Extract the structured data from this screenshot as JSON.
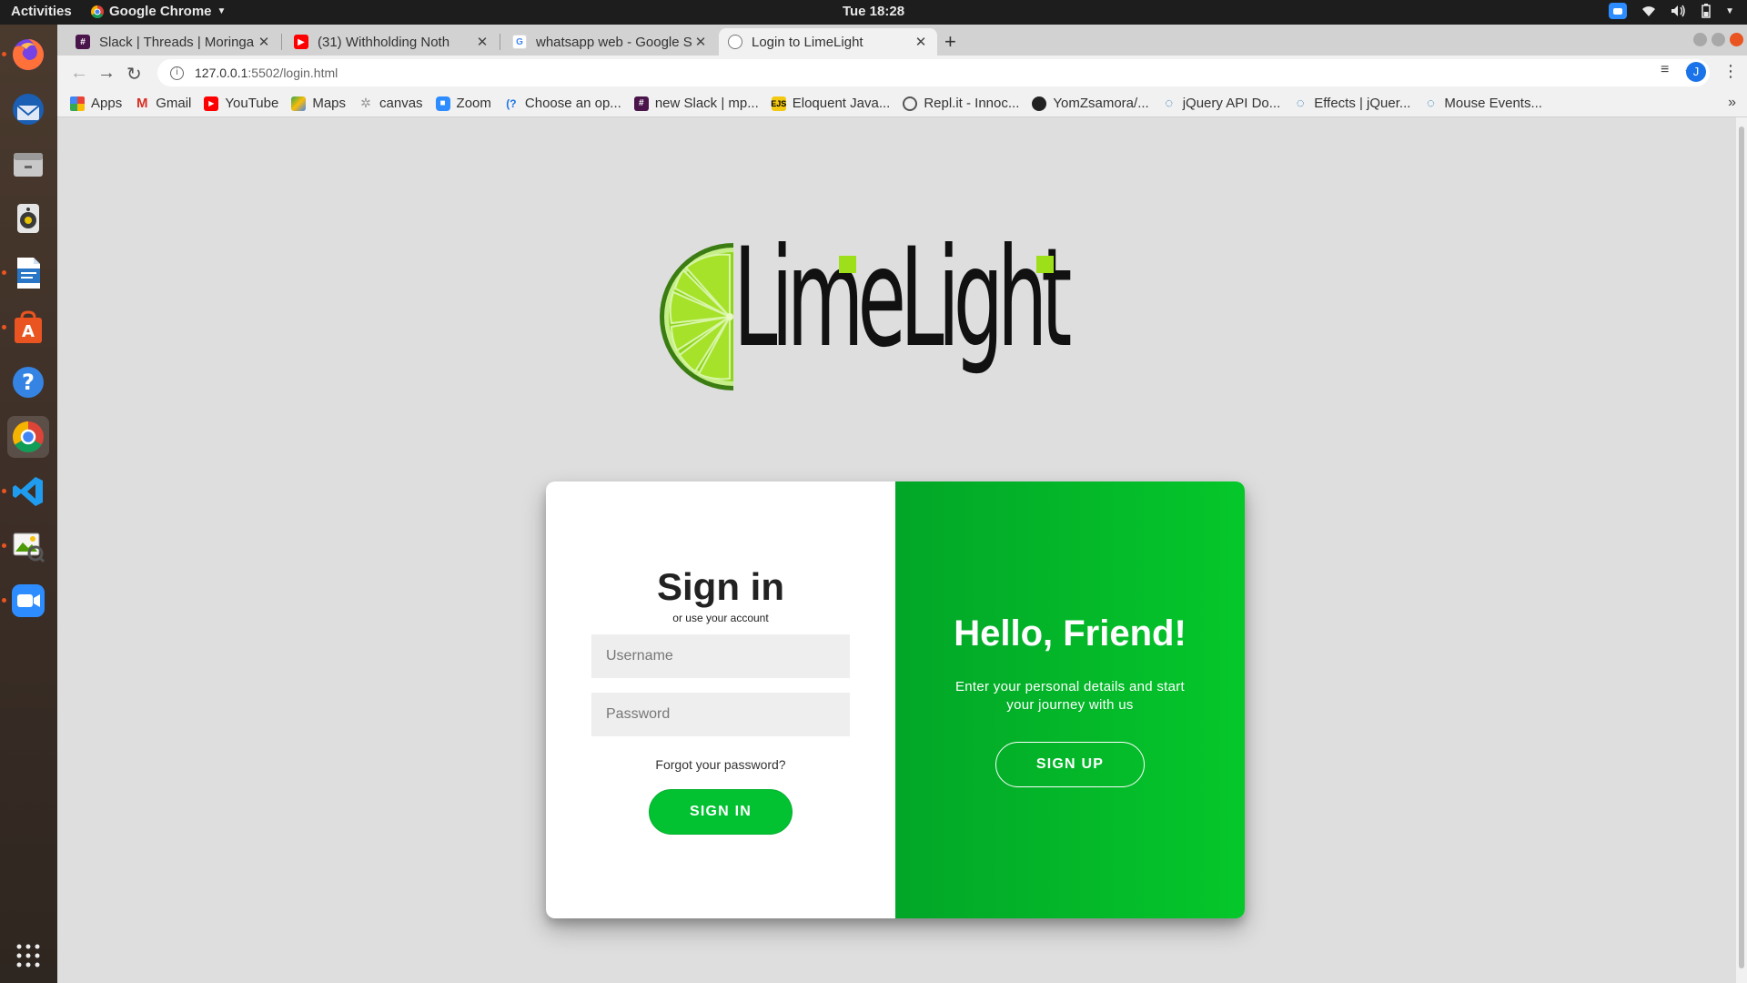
{
  "topbar": {
    "activities": "Activities",
    "app_name": "Google Chrome",
    "clock": "Tue 18:28"
  },
  "dock": {
    "items": [
      "firefox",
      "thunderbird",
      "files",
      "rhythmbox",
      "libreoffice-writer",
      "software-center",
      "help",
      "chrome",
      "vscode",
      "image-viewer",
      "zoom",
      "show-apps"
    ]
  },
  "browser": {
    "tabs": [
      {
        "title": "Slack | Threads | Moringa",
        "icon": "slack-icon"
      },
      {
        "title": "(31) Withholding Noth",
        "icon": "youtube-icon"
      },
      {
        "title": "whatsapp web - Google S",
        "icon": "google-icon"
      },
      {
        "title": "Login to LimeLight",
        "icon": "globe-icon",
        "active": true
      }
    ],
    "url_host": "127.0.0.1",
    "url_path": ":5502/login.html",
    "profile_initial": "J",
    "bookmarks": [
      {
        "label": "Apps",
        "icon": "apps-grid-icon"
      },
      {
        "label": "Gmail",
        "icon": "gmail-icon"
      },
      {
        "label": "YouTube",
        "icon": "youtube-icon"
      },
      {
        "label": "Maps",
        "icon": "maps-icon"
      },
      {
        "label": "canvas",
        "icon": "canvas-icon"
      },
      {
        "label": "Zoom",
        "icon": "zoom-icon"
      },
      {
        "label": "Choose an op...",
        "icon": "choose-icon"
      },
      {
        "label": "new Slack | mp...",
        "icon": "slack-icon"
      },
      {
        "label": "Eloquent Java...",
        "icon": "ejs-icon"
      },
      {
        "label": "Repl.it - Innoc...",
        "icon": "replit-icon"
      },
      {
        "label": "YomZsamora/...",
        "icon": "github-icon"
      },
      {
        "label": "jQuery API Do...",
        "icon": "jquery-icon"
      },
      {
        "label": "Effects | jQuer...",
        "icon": "jquery-icon"
      },
      {
        "label": "Mouse Events...",
        "icon": "jquery-icon"
      }
    ]
  },
  "page": {
    "logo_text": "LimeLight",
    "signin": {
      "title": "Sign in",
      "subtitle": "or use your account",
      "username_placeholder": "Username",
      "password_placeholder": "Password",
      "forgot": "Forgot your password?",
      "button": "SIGN IN"
    },
    "welcome": {
      "title": "Hello, Friend!",
      "text": "Enter your personal details and start your journey with us",
      "button": "SIGN UP"
    }
  },
  "colors": {
    "accent_green": "#02c232",
    "lime": "#9de01a",
    "ubuntu_orange": "#e95420"
  }
}
